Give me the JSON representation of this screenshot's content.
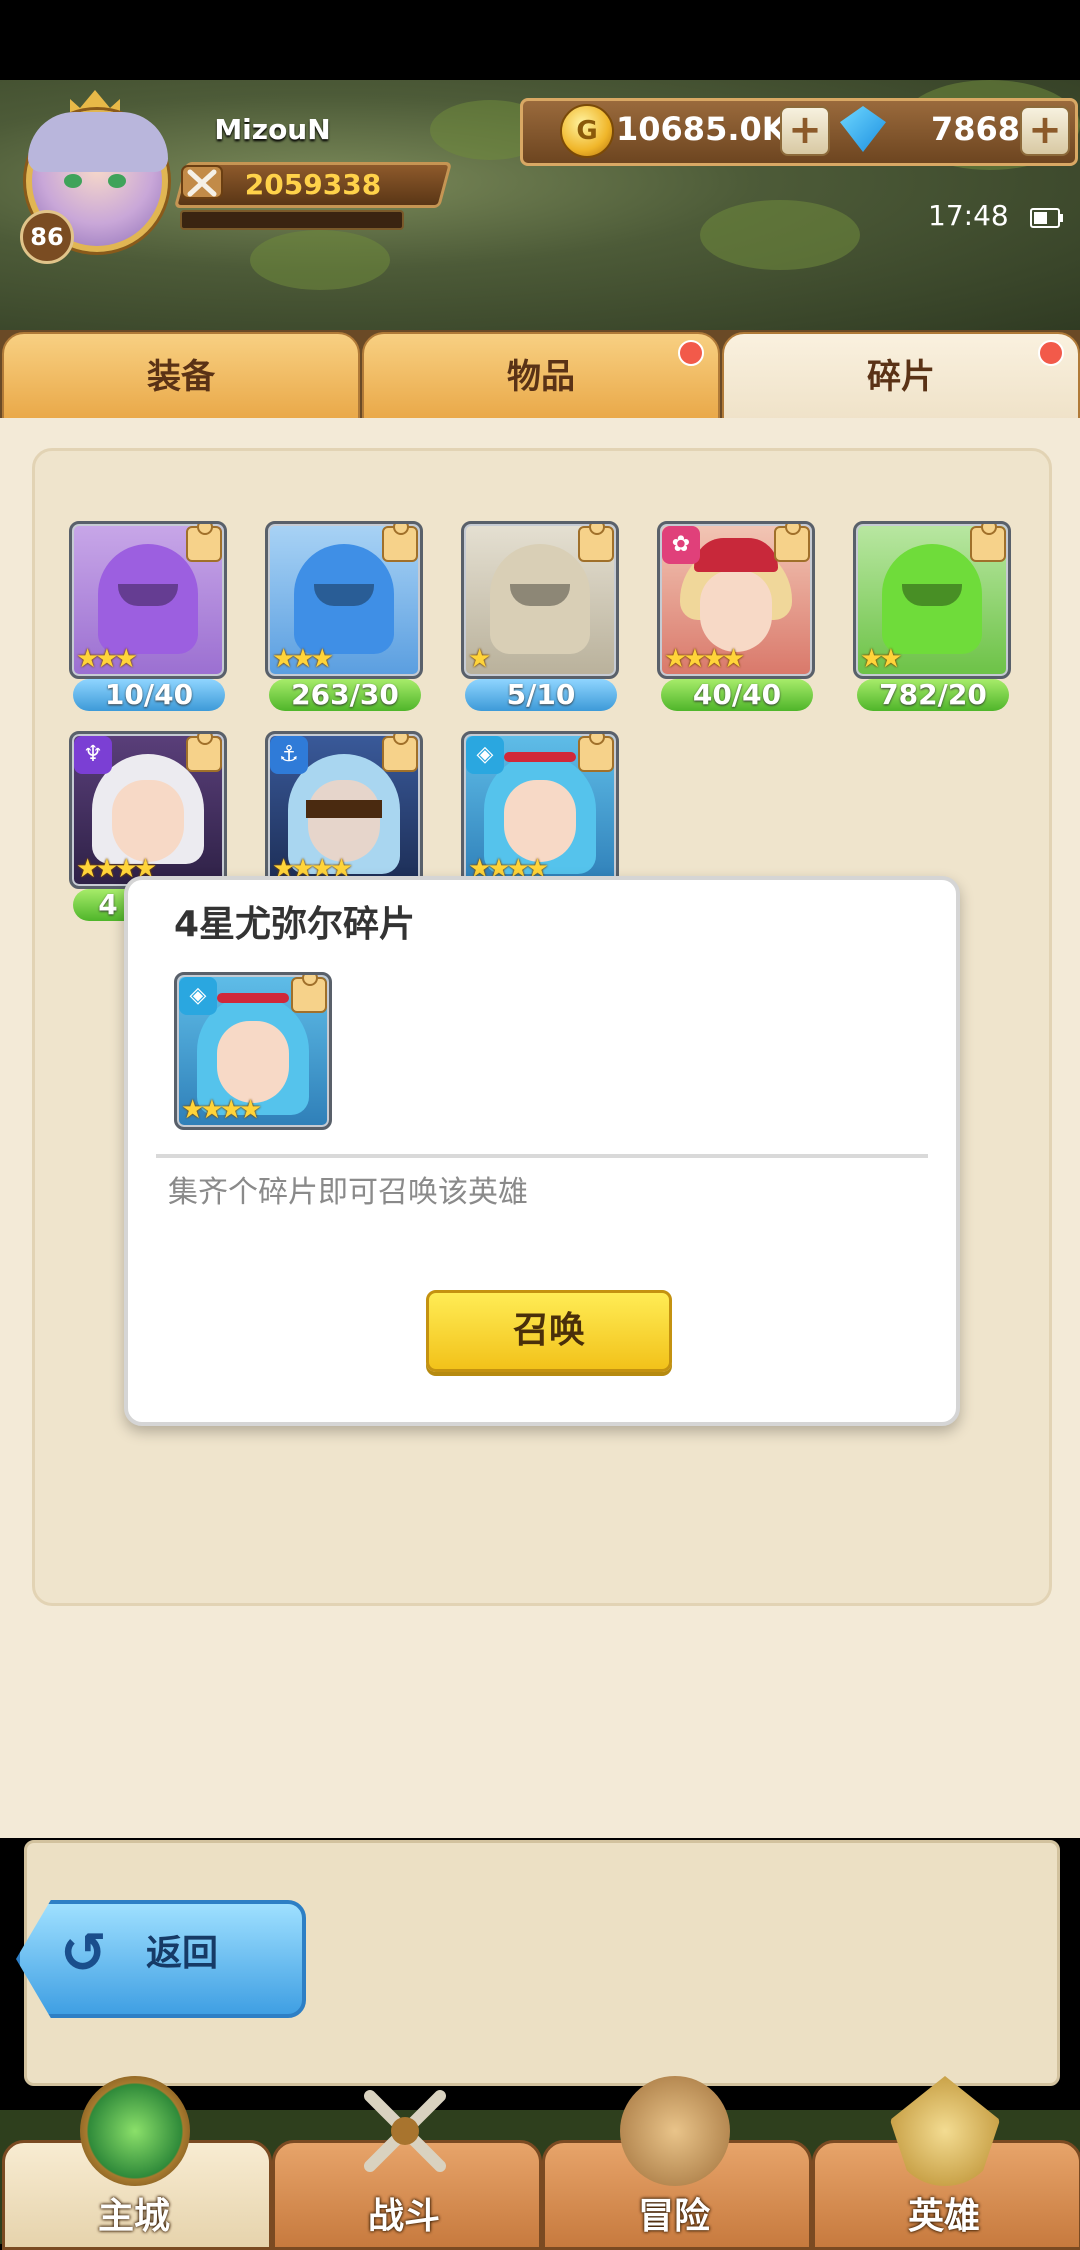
{
  "player": {
    "name": "MizouN",
    "level": "86",
    "power": "2059338",
    "exp_fraction": 0.0
  },
  "resources": {
    "gold": "10685.0K",
    "gems": "7868",
    "plus_symbol": "+"
  },
  "status": {
    "time": "17:48",
    "battery_level": 0.6
  },
  "tabs": [
    {
      "label": "装备",
      "badge": false
    },
    {
      "label": "物品",
      "badge": true
    },
    {
      "label": "碎片",
      "badge": true,
      "active": true
    }
  ],
  "fragments": [
    {
      "count": "10/40",
      "stars": 3,
      "type": "helmet-purple",
      "count_color": "blue"
    },
    {
      "count": "263/30",
      "stars": 3,
      "type": "helmet-blue",
      "count_color": "green"
    },
    {
      "count": "5/10",
      "stars": 1,
      "type": "helmet-beige",
      "count_color": "blue"
    },
    {
      "count": "40/40",
      "stars": 4,
      "type": "hero-red-warrior",
      "count_color": "green"
    },
    {
      "count": "782/20",
      "stars": 2,
      "type": "helmet-green",
      "count_color": "green"
    },
    {
      "count": "4",
      "stars": 4,
      "type": "hero-white-hair",
      "count_color": "green"
    },
    {
      "count": "",
      "stars": 4,
      "type": "hero-blindfold",
      "count_color": "blue"
    },
    {
      "count": "",
      "stars": 4,
      "type": "hero-blue-hair",
      "count_color": "blue"
    }
  ],
  "popup": {
    "title": "4星尤弥尔碎片",
    "description": "集齐个碎片即可召唤该英雄",
    "summon_label": "召唤",
    "stars": 4
  },
  "back_label": "返回",
  "back_icon": "↺",
  "nav": [
    {
      "label": "主城",
      "icon": "castle-emblem-icon",
      "active": true
    },
    {
      "label": "战斗",
      "icon": "crossed-swords-icon"
    },
    {
      "label": "冒险",
      "icon": "adventure-map-icon"
    },
    {
      "label": "英雄",
      "icon": "hero-crest-icon"
    }
  ],
  "colors": {
    "star": "#ffd43a",
    "tab_active": "#faf1df",
    "summon_button": "#f2c21a",
    "badge": "#f25a4a"
  }
}
